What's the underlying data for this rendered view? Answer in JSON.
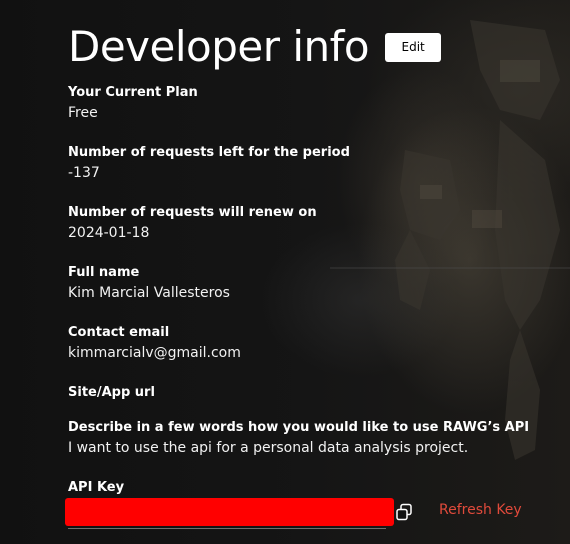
{
  "page": {
    "title": "Developer info",
    "edit_label": "Edit"
  },
  "fields": {
    "plan": {
      "label": "Your Current Plan",
      "value": "Free"
    },
    "requests_left": {
      "label": "Number of requests left for the period",
      "value": "-137"
    },
    "renew": {
      "label": "Number of requests will renew on",
      "value": "2024-01-18"
    },
    "full_name": {
      "label": "Full name",
      "value": "Kim Marcial Vallesteros"
    },
    "email": {
      "label": "Contact email",
      "value": "kimmarcialv@gmail.com"
    },
    "site_url": {
      "label": "Site/App url",
      "value": ""
    },
    "usage": {
      "label": "Describe in a few words how you would like to use RAWG’s API",
      "value": "I want to use the api for a personal data analysis project."
    },
    "api_key": {
      "label": "API Key",
      "value": "",
      "redaction_color": "#ff0000"
    }
  },
  "actions": {
    "copy_icon": "copy-icon",
    "refresh_label": "Refresh Key",
    "refresh_color": "#e04a3b"
  }
}
